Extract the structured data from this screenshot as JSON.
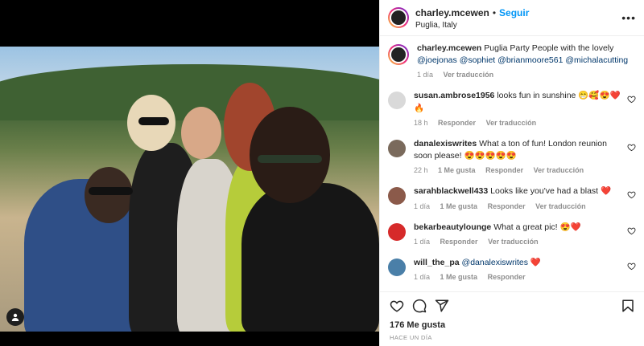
{
  "post": {
    "username": "charley.mcewen",
    "follow_label": "Seguir",
    "location": "Puglia, Italy",
    "more_label": "•••"
  },
  "caption": {
    "username": "charley.mcewen",
    "text": "Puglia Party People with the lovely",
    "mentions": [
      "@joejonas",
      "@sophiet",
      "@brianmoore561",
      "@michalacutting"
    ],
    "time": "1 día",
    "translate": "Ver traducción"
  },
  "comments": [
    {
      "username": "susan.ambrose1956",
      "text": "looks fun in sunshine 😁🥰😍❤️🔥",
      "time": "18 h",
      "likes": "",
      "reply": "Responder",
      "translate": "Ver traducción",
      "avatar_color": "#d9d9d9"
    },
    {
      "username": "danalexiswrites",
      "text": "What a ton of fun! London reunion soon please! 😍😍😍😍😍",
      "time": "22 h",
      "likes": "1 Me gusta",
      "reply": "Responder",
      "translate": "Ver traducción",
      "avatar_color": "#7a6a5c"
    },
    {
      "username": "sarahblackwell433",
      "text": "Looks like you've had a blast ❤️",
      "time": "1 día",
      "likes": "1 Me gusta",
      "reply": "Responder",
      "translate": "Ver traducción",
      "avatar_color": "#8b5a4a"
    },
    {
      "username": "bekarbeautylounge",
      "text": "What a great pic! 😍❤️",
      "time": "1 día",
      "likes": "",
      "reply": "Responder",
      "translate": "Ver traducción",
      "avatar_color": "#d62a2a"
    },
    {
      "username": "will_the_pa",
      "mention": "@danalexiswrites",
      "text": "❤️",
      "time": "1 día",
      "likes": "1 Me gusta",
      "reply": "Responder",
      "translate": "",
      "avatar_color": "#4a7fa8"
    }
  ],
  "footer": {
    "likes": "176 Me gusta",
    "date": "HACE UN DÍA"
  },
  "icons": {
    "heart": "heart-icon",
    "comment": "comment-icon",
    "share": "share-icon",
    "save": "bookmark-icon",
    "tag": "user-tag-icon"
  },
  "colors": {
    "follow": "#0095f6",
    "mention": "#00376b",
    "muted": "#8e8e8e"
  }
}
